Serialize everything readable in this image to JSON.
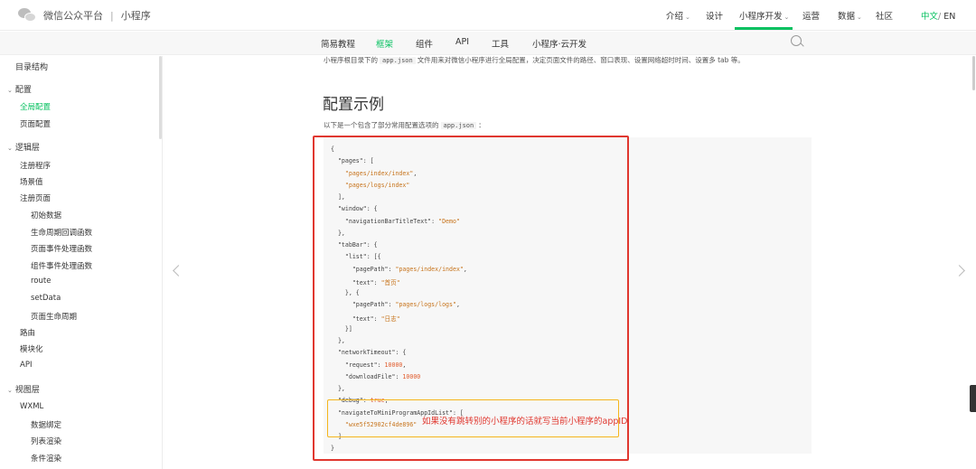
{
  "header": {
    "brand": "微信公众平台",
    "separator": "|",
    "product": "小程序",
    "nav": [
      {
        "label": "介绍",
        "caret": "⌄"
      },
      {
        "label": "设计",
        "caret": ""
      },
      {
        "label": "小程序开发",
        "caret": "⌄"
      },
      {
        "label": "运营",
        "caret": ""
      },
      {
        "label": "数据",
        "caret": "⌄"
      },
      {
        "label": "社区",
        "caret": ""
      }
    ],
    "lang_zh": "中文",
    "lang_sep": "/",
    "lang_en": "EN"
  },
  "subnav": {
    "items": [
      "简易教程",
      "框架",
      "组件",
      "API",
      "工具",
      "小程序·云开发"
    ],
    "active": "框架"
  },
  "sidebar": {
    "items": [
      {
        "label": "目录结构",
        "level": 0
      },
      {
        "label": "配置",
        "level": 0,
        "chevron": "⌄"
      },
      {
        "label": "全局配置",
        "level": 1,
        "active": true
      },
      {
        "label": "页面配置",
        "level": 1
      },
      {
        "label": "逻辑层",
        "level": 0,
        "chevron": "⌄"
      },
      {
        "label": "注册程序",
        "level": 1
      },
      {
        "label": "场景值",
        "level": 1
      },
      {
        "label": "注册页面",
        "level": 1
      },
      {
        "label": "初始数据",
        "level": 2
      },
      {
        "label": "生命周期回调函数",
        "level": 2
      },
      {
        "label": "页面事件处理函数",
        "level": 2
      },
      {
        "label": "组件事件处理函数",
        "level": 2
      },
      {
        "label": "route",
        "level": 2
      },
      {
        "label": "setData",
        "level": 2
      },
      {
        "label": "页面生命周期",
        "level": 2
      },
      {
        "label": "路由",
        "level": 1
      },
      {
        "label": "模块化",
        "level": 1
      },
      {
        "label": "API",
        "level": 1
      },
      {
        "label": "视图层",
        "level": 0,
        "chevron": "⌄"
      },
      {
        "label": "WXML",
        "level": 1
      },
      {
        "label": "数据绑定",
        "level": 2
      },
      {
        "label": "列表渲染",
        "level": 2
      },
      {
        "label": "条件渲染",
        "level": 2
      }
    ]
  },
  "main": {
    "intro_before": "小程序根目录下的",
    "intro_code": "app.json",
    "intro_after": "文件用来对微信小程序进行全局配置，决定页面文件的路径、窗口表现、设置网络超时时间、设置多 tab 等。",
    "heading": "配置示例",
    "desc_before": "以下是一个包含了部分常用配置选项的",
    "desc_code": "app.json",
    "desc_after": "：",
    "annotation": "如果没有跳转别的小程序的话就写当前小程序的appID",
    "code_lines": [
      [
        {
          "t": "{",
          "c": "k"
        }
      ],
      [
        {
          "t": "  \"pages\": [",
          "c": "k"
        }
      ],
      [
        {
          "t": "    \"pages/index/index\"",
          "c": "s"
        },
        {
          "t": ",",
          "c": "k"
        }
      ],
      [
        {
          "t": "    \"pages/logs/index\"",
          "c": "s"
        }
      ],
      [
        {
          "t": "  ],",
          "c": "k"
        }
      ],
      [
        {
          "t": "  \"window\": {",
          "c": "k"
        }
      ],
      [
        {
          "t": "    \"navigationBarTitleText\": ",
          "c": "k"
        },
        {
          "t": "\"Demo\"",
          "c": "s"
        }
      ],
      [
        {
          "t": "  },",
          "c": "k"
        }
      ],
      [
        {
          "t": "  \"tabBar\": {",
          "c": "k"
        }
      ],
      [
        {
          "t": "    \"list\": [{",
          "c": "k"
        }
      ],
      [
        {
          "t": "      \"pagePath\": ",
          "c": "k"
        },
        {
          "t": "\"pages/index/index\"",
          "c": "s"
        },
        {
          "t": ",",
          "c": "k"
        }
      ],
      [
        {
          "t": "      \"text\": ",
          "c": "k"
        },
        {
          "t": "\"首页\"",
          "c": "s"
        }
      ],
      [
        {
          "t": "    }, {",
          "c": "k"
        }
      ],
      [
        {
          "t": "      \"pagePath\": ",
          "c": "k"
        },
        {
          "t": "\"pages/logs/logs\"",
          "c": "s"
        },
        {
          "t": ",",
          "c": "k"
        }
      ],
      [
        {
          "t": "      \"text\": ",
          "c": "k"
        },
        {
          "t": "\"日志\"",
          "c": "s"
        }
      ],
      [
        {
          "t": "    }]",
          "c": "k"
        }
      ],
      [
        {
          "t": "  },",
          "c": "k"
        }
      ],
      [
        {
          "t": "  \"networkTimeout\": {",
          "c": "k"
        }
      ],
      [
        {
          "t": "    \"request\": ",
          "c": "k"
        },
        {
          "t": "10000",
          "c": "n"
        },
        {
          "t": ",",
          "c": "k"
        }
      ],
      [
        {
          "t": "    \"downloadFile\": ",
          "c": "k"
        },
        {
          "t": "10000",
          "c": "n"
        }
      ],
      [
        {
          "t": "  },",
          "c": "k"
        }
      ],
      [
        {
          "t": "  \"debug\": ",
          "c": "k"
        },
        {
          "t": "true",
          "c": "n"
        },
        {
          "t": ",",
          "c": "k"
        }
      ],
      [
        {
          "t": "  \"navigateToMiniProgramAppIdList\": [",
          "c": "k"
        }
      ],
      [
        {
          "t": "    \"wxe5f52902cf4de896\"",
          "c": "s"
        }
      ],
      [
        {
          "t": "  ]",
          "c": "k"
        }
      ],
      [
        {
          "t": "}",
          "c": "k"
        }
      ]
    ]
  },
  "colors": {
    "accent": "#07c160",
    "highlight_red": "#e0372f",
    "highlight_orange": "#f5b51c"
  },
  "icons": {
    "logo": "wechat-logo-icon",
    "search": "search-icon",
    "prev": "chevron-left-icon",
    "next": "chevron-right-icon"
  }
}
